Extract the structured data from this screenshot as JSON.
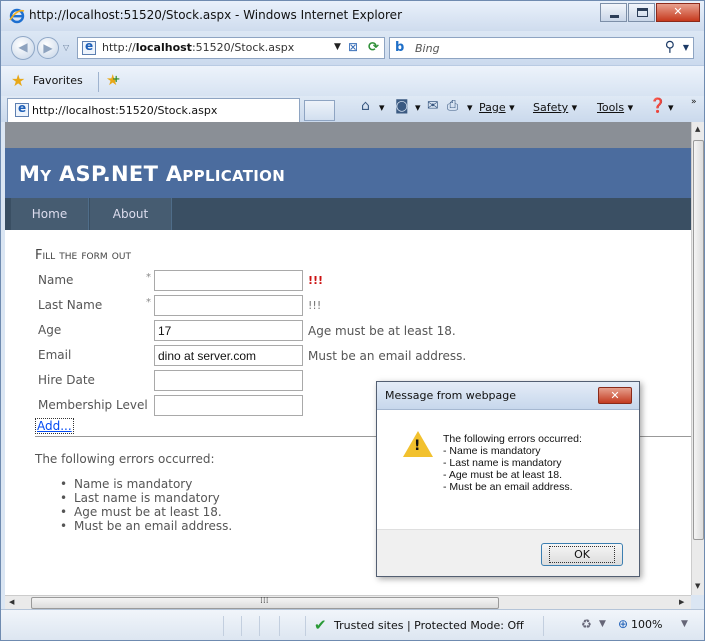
{
  "browser": {
    "title": "http://localhost:51520/Stock.aspx - Windows Internet Explorer",
    "address_prefix": "http://",
    "address_host": "localhost",
    "address_suffix": ":51520/Stock.aspx",
    "search_placeholder": "Bing",
    "favorites_label": "Favorites",
    "tab_label": "http://localhost:51520/Stock.aspx",
    "commands": {
      "page": "Page",
      "safety": "Safety",
      "tools": "Tools"
    },
    "status_text": "Trusted sites | Protected Mode: Off",
    "zoom": "100%"
  },
  "site": {
    "app_title": "My ASP.NET Application",
    "menu": [
      {
        "label": "Home"
      },
      {
        "label": "About"
      }
    ]
  },
  "form": {
    "heading": "Fill the form out",
    "rows": [
      {
        "label": "Name",
        "required": "*",
        "value": "",
        "message": "!!!"
      },
      {
        "label": "Last Name",
        "required": "*",
        "value": "",
        "message": "!!!"
      },
      {
        "label": "Age",
        "required": "",
        "value": "17",
        "message": "Age must be at least 18."
      },
      {
        "label": "Email",
        "required": "",
        "value": "dino at server.com",
        "message": "Must be an email address."
      },
      {
        "label": "Hire Date",
        "required": "",
        "value": "",
        "message": ""
      },
      {
        "label": "Membership Level",
        "required": "",
        "value": "",
        "message": ""
      }
    ],
    "add_link": "Add..."
  },
  "summary": {
    "heading": "The following errors occurred:",
    "items": [
      "Name is mandatory",
      "Last name is mandatory",
      "Age must be at least 18.",
      "Must be an email address."
    ]
  },
  "dialog": {
    "title": "Message from webpage",
    "close_label": "✕",
    "lines": [
      "The following errors occurred:",
      "- Name is mandatory",
      "- Last name is mandatory",
      "- Age must be at least 18.",
      "- Must be an email address."
    ],
    "ok_label": "OK"
  },
  "colors": {
    "header_bg": "#4b6c9e",
    "menu_bg": "#3a4f63",
    "link": "#034af3",
    "error_red": "#cc1111"
  }
}
